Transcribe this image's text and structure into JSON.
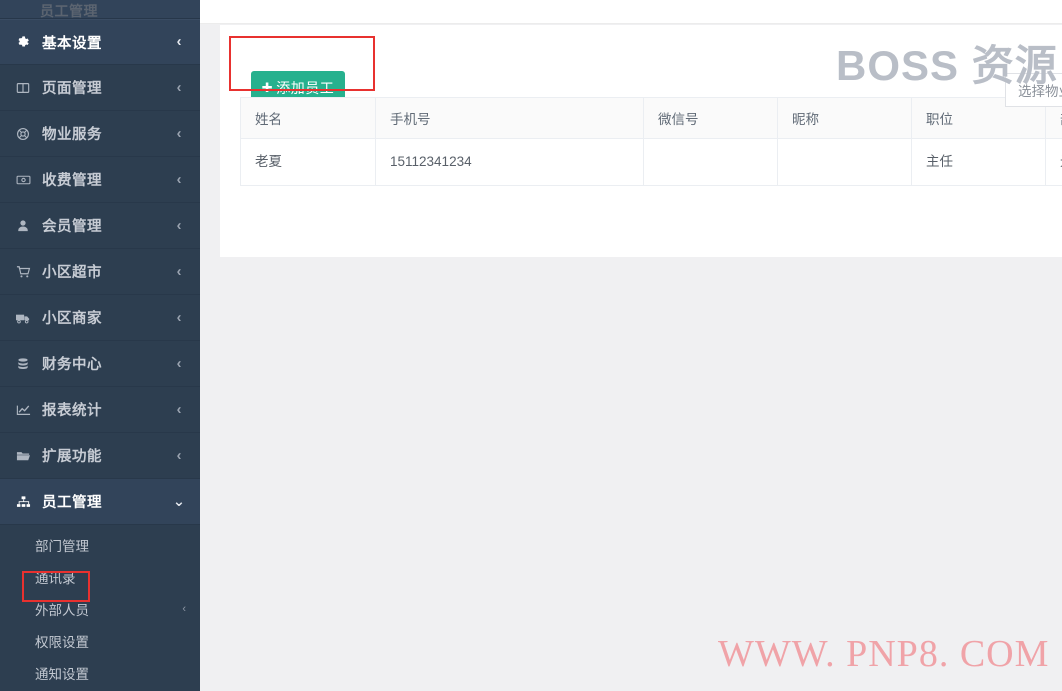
{
  "sidebar": {
    "items": [
      {
        "label": "基本设置",
        "icon": "gear-icon",
        "chevron": "‹",
        "state": "highlighted"
      },
      {
        "label": "页面管理",
        "icon": "columns-icon",
        "chevron": "‹",
        "state": "normal"
      },
      {
        "label": "物业服务",
        "icon": "life-ring-icon",
        "chevron": "‹",
        "state": "normal"
      },
      {
        "label": "收费管理",
        "icon": "money-icon",
        "chevron": "‹",
        "state": "normal"
      },
      {
        "label": "会员管理",
        "icon": "user-icon",
        "chevron": "‹",
        "state": "normal"
      },
      {
        "label": "小区超市",
        "icon": "shopping-cart-icon",
        "chevron": "‹",
        "state": "normal"
      },
      {
        "label": "小区商家",
        "icon": "truck-icon",
        "chevron": "‹",
        "state": "normal"
      },
      {
        "label": "财务中心",
        "icon": "database-icon",
        "chevron": "‹",
        "state": "normal"
      },
      {
        "label": "报表统计",
        "icon": "chart-line-icon",
        "chevron": "‹",
        "state": "normal"
      },
      {
        "label": "扩展功能",
        "icon": "folder-open-icon",
        "chevron": "‹",
        "state": "normal"
      },
      {
        "label": "员工管理",
        "icon": "sitemap-icon",
        "chevron": "⌄",
        "state": "active-expanded"
      }
    ],
    "submenu": [
      {
        "label": "部门管理",
        "chevron": "",
        "selected": false
      },
      {
        "label": "通讯录",
        "chevron": "",
        "selected": true
      },
      {
        "label": "外部人员",
        "chevron": "‹",
        "selected": false
      },
      {
        "label": "权限设置",
        "chevron": "",
        "selected": false
      },
      {
        "label": "通知设置",
        "chevron": "",
        "selected": false
      }
    ]
  },
  "page": {
    "title": "员工管理"
  },
  "toolbar": {
    "add_button_label": "添加员工",
    "add_button_icon": "plus-icon",
    "add_button_color": "#26b18e",
    "select_placeholder": "选择物业"
  },
  "table": {
    "headers": [
      "姓名",
      "手机号",
      "微信号",
      "昵称",
      "职位",
      "部门"
    ],
    "rows": [
      {
        "姓名": "老夏",
        "手机号": "15112341234",
        "微信号": "",
        "昵称": "",
        "职位": "主任",
        "部门": "光大公司"
      }
    ]
  },
  "annotations": {
    "highlight_color": "#e8312f",
    "boxes": [
      "add-employee-button",
      "submenu-item-通讯录"
    ]
  },
  "watermarks": {
    "brand": "BOSS 资源",
    "brand_color": "#b9bec7",
    "url": "WWW. PNP8. COM",
    "url_color": "#f0a3a8"
  }
}
